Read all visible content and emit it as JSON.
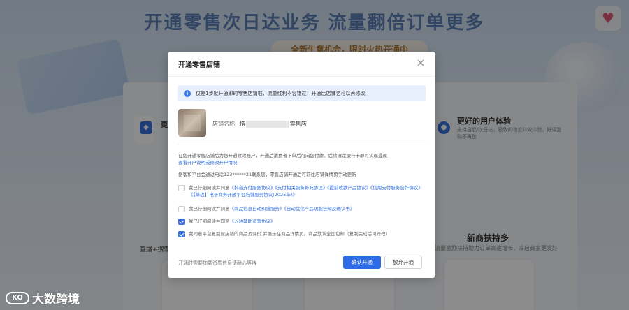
{
  "background": {
    "headline": "开通零售次日达业务  流量翻倍订单更多",
    "subheadline": "全新生意机会，限时火热开通中",
    "feature_left_label": "更",
    "feature_right_title": "更好的用户体验",
    "feature_right_desc": "支持自品/次日达，极致的物流时效体验，好评复购不再愁",
    "section_title": "新商扶持多",
    "section_desc": "流量激励扶持助力订单高速增长，冷启商家更发好",
    "left_desc": "直播+搜索",
    "logo_mark": "KO",
    "logo_text": "大数跨境"
  },
  "modal": {
    "title": "开通零售店铺",
    "notice": "仅差1步就开通即时零售店铺啦，流量红利不容错过！开通后店铺名可以再修改",
    "store_name_label": "店铺名称:",
    "store_name_prefix": "搭",
    "store_name_suffix": "零售店",
    "desc1": "在您开通零售店铺后为您开通收款账户，开通后消费者下单后可向您付款。后续绑定银行卡即可实现提现",
    "desc1_link": "查看开户说明或修改开户情况",
    "desc2": "据客和平台会通过电话123******21联系您，零售店铺开通后可前往店铺详情页手动更新",
    "agreements": [
      {
        "checked": false,
        "prefix": "我已仔细阅读并同意",
        "link": "《抖音支付服务协议》《支付相关服务补充协议》《提前收款产品协议》《信用支付服务合作协议》《【草迟】电子商务开放平台店铺服务协议(2025年)》"
      },
      {
        "checked": false,
        "prefix": "我已仔细阅读并同意",
        "link": "《商品信息自动纠错服务》《自动优化产品功能告知及确认书》"
      },
      {
        "checked": true,
        "prefix": "我已仔细阅读并同意",
        "link": "《入驻辅助运营协议》"
      },
      {
        "checked": true,
        "prefix": "我同意平台复制原店铺的商品及评价,并展示在商品详情页。商品默认全国包邮（复制完成后可修改）",
        "link": ""
      }
    ],
    "footer_note": "开通时需要加载资质信息请耐心等待",
    "confirm_button": "确认开通",
    "cancel_button": "放弃开通"
  },
  "colors": {
    "primary": "#2e6be6",
    "link": "#2f6fe0",
    "notice_bg": "#e8f0fd"
  }
}
